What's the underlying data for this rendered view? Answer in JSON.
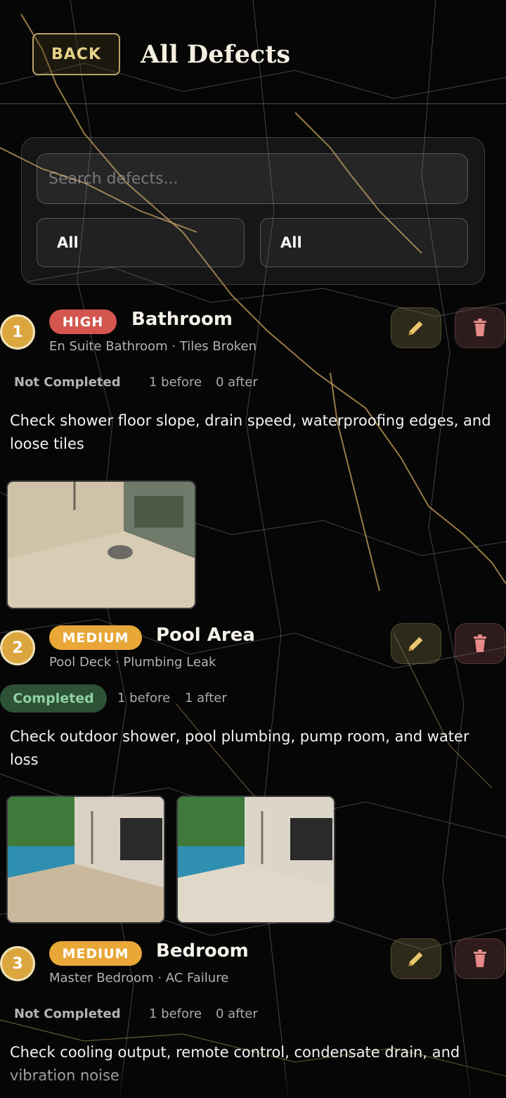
{
  "header": {
    "back_label": "BACK",
    "title": "All Defects"
  },
  "filters": {
    "search_placeholder": "Search defects...",
    "filter_one_value": "All",
    "filter_two_value": "All"
  },
  "defects": [
    {
      "number": "1",
      "priority": "HIGH",
      "room": "Bathroom",
      "location": "En Suite Bathroom · Tiles Broken",
      "status": "Not Completed",
      "before": "1 before",
      "after": "0 after",
      "description": "Check shower floor slope, drain speed, waterproofing edges, and loose tiles"
    },
    {
      "number": "2",
      "priority": "MEDIUM",
      "room": "Pool Area",
      "location": "Pool Deck · Plumbing Leak",
      "status": "Completed",
      "before": "1 before",
      "after": "1 after",
      "description": "Check outdoor shower, pool plumbing, pump room, and water loss"
    },
    {
      "number": "3",
      "priority": "MEDIUM",
      "room": "Bedroom",
      "location": "Master Bedroom · AC Failure",
      "status": "Not Completed",
      "before": "1 before",
      "after": "0 after",
      "description": "Check cooling output, remote control, condensate drain, and vibration noise"
    }
  ],
  "colors": {
    "accent_gold": "#dca63f",
    "priority_high": "#d4564e",
    "priority_medium": "#e8a737",
    "completed_green": "#8fd1a0"
  },
  "icons": [
    "pencil-icon",
    "trash-icon"
  ]
}
